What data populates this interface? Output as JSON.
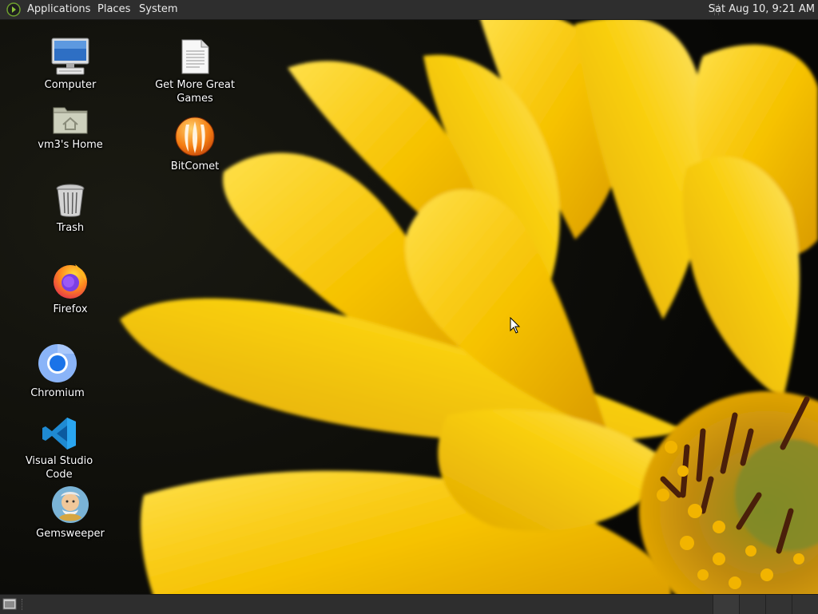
{
  "top_panel": {
    "menus": [
      "Applications",
      "Places",
      "System"
    ],
    "clock": "Sat Aug 10,  9:21 AM"
  },
  "desktop": {
    "icons": [
      {
        "label": "Computer",
        "icon": "computer-icon"
      },
      {
        "label": "vm3's Home",
        "icon": "home-folder-icon"
      },
      {
        "label": "Trash",
        "icon": "trash-icon"
      },
      {
        "label": "Firefox",
        "icon": "firefox-icon"
      },
      {
        "label": "Chromium",
        "icon": "chromium-icon"
      },
      {
        "label": "Visual Studio Code",
        "icon": "vscode-icon"
      },
      {
        "label": "Gemsweeper",
        "icon": "gemsweeper-icon"
      },
      {
        "label": "Get More Great Games",
        "icon": "document-icon"
      },
      {
        "label": "BitComet",
        "icon": "bitcomet-icon"
      }
    ]
  },
  "colors": {
    "panel": "#2e2e2e",
    "panel_text": "#eaeaea",
    "wallpaper_petal": "#f5c400",
    "wallpaper_bg": "#0b0b08"
  }
}
